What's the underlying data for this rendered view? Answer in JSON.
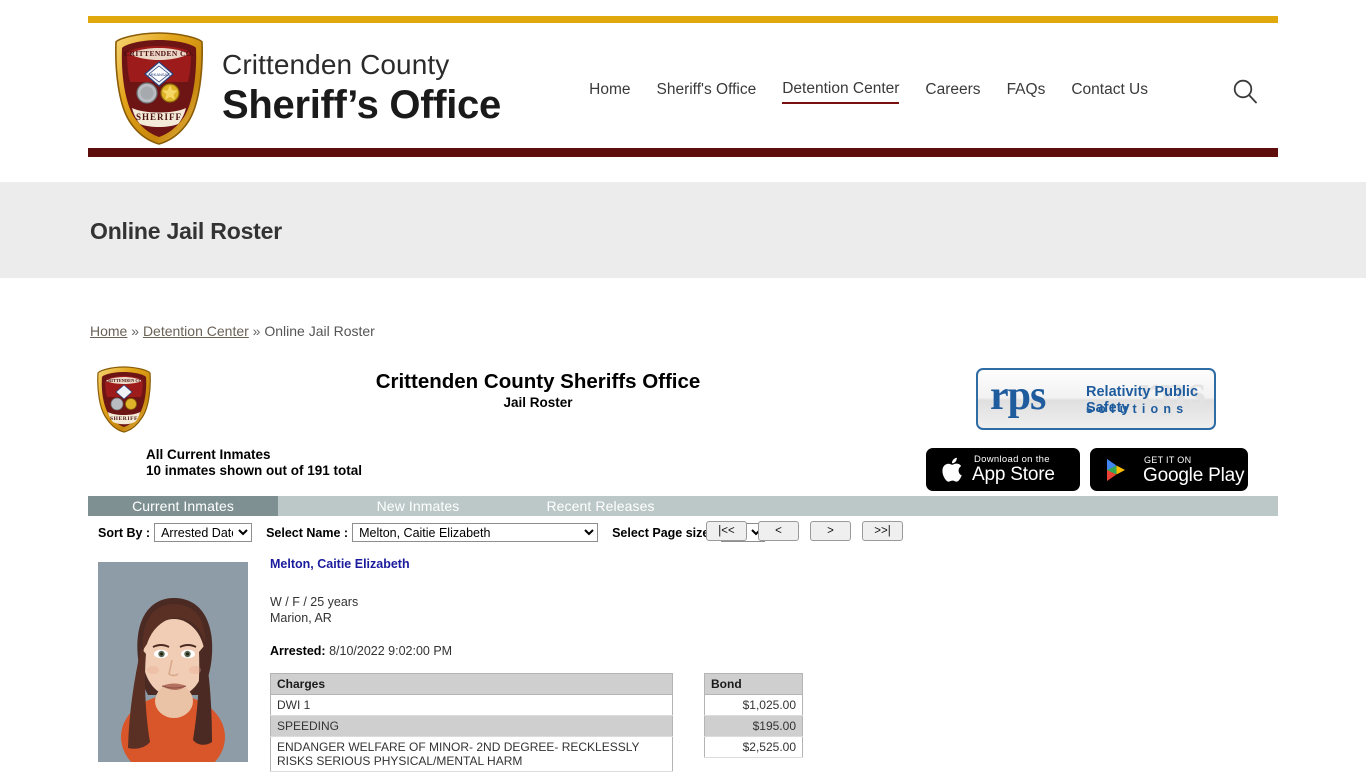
{
  "site": {
    "brand_line1": "Crittenden County",
    "brand_line2": "Sheriff’s Office",
    "nav": [
      {
        "label": "Home",
        "active": false
      },
      {
        "label": "Sheriff's Office",
        "active": false
      },
      {
        "label": "Detention Center",
        "active": true
      },
      {
        "label": "Careers",
        "active": false
      },
      {
        "label": "FAQs",
        "active": false
      },
      {
        "label": "Contact Us",
        "active": false
      }
    ],
    "search_icon": "search-icon",
    "colors": {
      "gold_bar": "#e0a80d",
      "maroon_bar": "#5e0d0d",
      "banner_bg": "#ececec",
      "tab_bar": "#bcc8c8",
      "tab_active": "#7e9092",
      "link": "#1b1b9e"
    }
  },
  "page": {
    "title": "Online Jail Roster"
  },
  "breadcrumb": {
    "items": [
      {
        "label": "Home",
        "link": true
      },
      {
        "label": "Detention Center",
        "link": true
      },
      {
        "label": "Online Jail Roster",
        "link": false
      }
    ],
    "separator": "»"
  },
  "roster": {
    "title": "Crittenden County Sheriffs Office",
    "subtitle": "Jail Roster",
    "scope_label": "All Current Inmates",
    "count_label": "10 inmates shown out of 191 total",
    "rps": {
      "mark": "rps",
      "ghost": "rps",
      "line1": "Relativity Public Safety",
      "line2": "solutions"
    },
    "stores": {
      "apple_small": "Download on the",
      "apple_big": "App Store",
      "google_small": "GET IT ON",
      "google_big": "Google Play"
    },
    "tabs": [
      {
        "label": "Current Inmates",
        "active": true
      },
      {
        "label": "New Inmates",
        "active": false
      },
      {
        "label": "Recent Releases",
        "active": false
      }
    ],
    "controls": {
      "sort_label": "Sort By :",
      "sort_value": "Arrested Date",
      "name_label": "Select Name :",
      "name_value": "Melton, Caitie Elizabeth",
      "page_label": "Select Page size :",
      "page_value": "10"
    },
    "pager": {
      "first": "|<<",
      "prev": "<",
      "next": ">",
      "last": ">>|"
    },
    "inmate": {
      "name": "Melton, Caitie Elizabeth",
      "demographics": "W / F / 25 years",
      "city_state": "Marion, AR",
      "arrested_label": "Arrested:",
      "arrested_value": "8/10/2022 9:02:00 PM",
      "charges_header": "Charges",
      "bond_header": "Bond",
      "charges": [
        {
          "charge": "DWI 1",
          "bond": "$1,025.00",
          "alt": false
        },
        {
          "charge": "SPEEDING",
          "bond": "$195.00",
          "alt": true
        },
        {
          "charge": "ENDANGER WELFARE OF MINOR- 2ND DEGREE- RECKLESSLY RISKS SERIOUS PHYSICAL/MENTAL HARM",
          "bond": "$2,525.00",
          "alt": false
        }
      ]
    }
  }
}
